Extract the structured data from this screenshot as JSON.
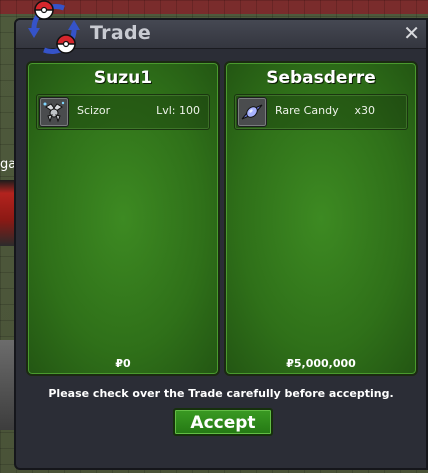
{
  "window": {
    "title": "Trade",
    "close_glyph": "✕",
    "icon": "trade-swap-pokeballs-icon"
  },
  "world": {
    "text_fragment": "ga"
  },
  "left_panel": {
    "player_name": "Suzu1",
    "item": {
      "icon": "scizor-sprite-icon",
      "name": "Scizor",
      "detail": "Lvl: 100"
    },
    "money": "₽0"
  },
  "right_panel": {
    "player_name": "Sebasderre",
    "item": {
      "icon": "rare-candy-icon",
      "name": "Rare Candy",
      "detail": "x30"
    },
    "money": "₽5,000,000"
  },
  "notice": "Please check over the Trade carefully before accepting.",
  "accept_label": "Accept",
  "colors": {
    "panel_green": "#2f7019",
    "accept_green": "#3a9a23",
    "window_bg": "#2b2d36"
  }
}
